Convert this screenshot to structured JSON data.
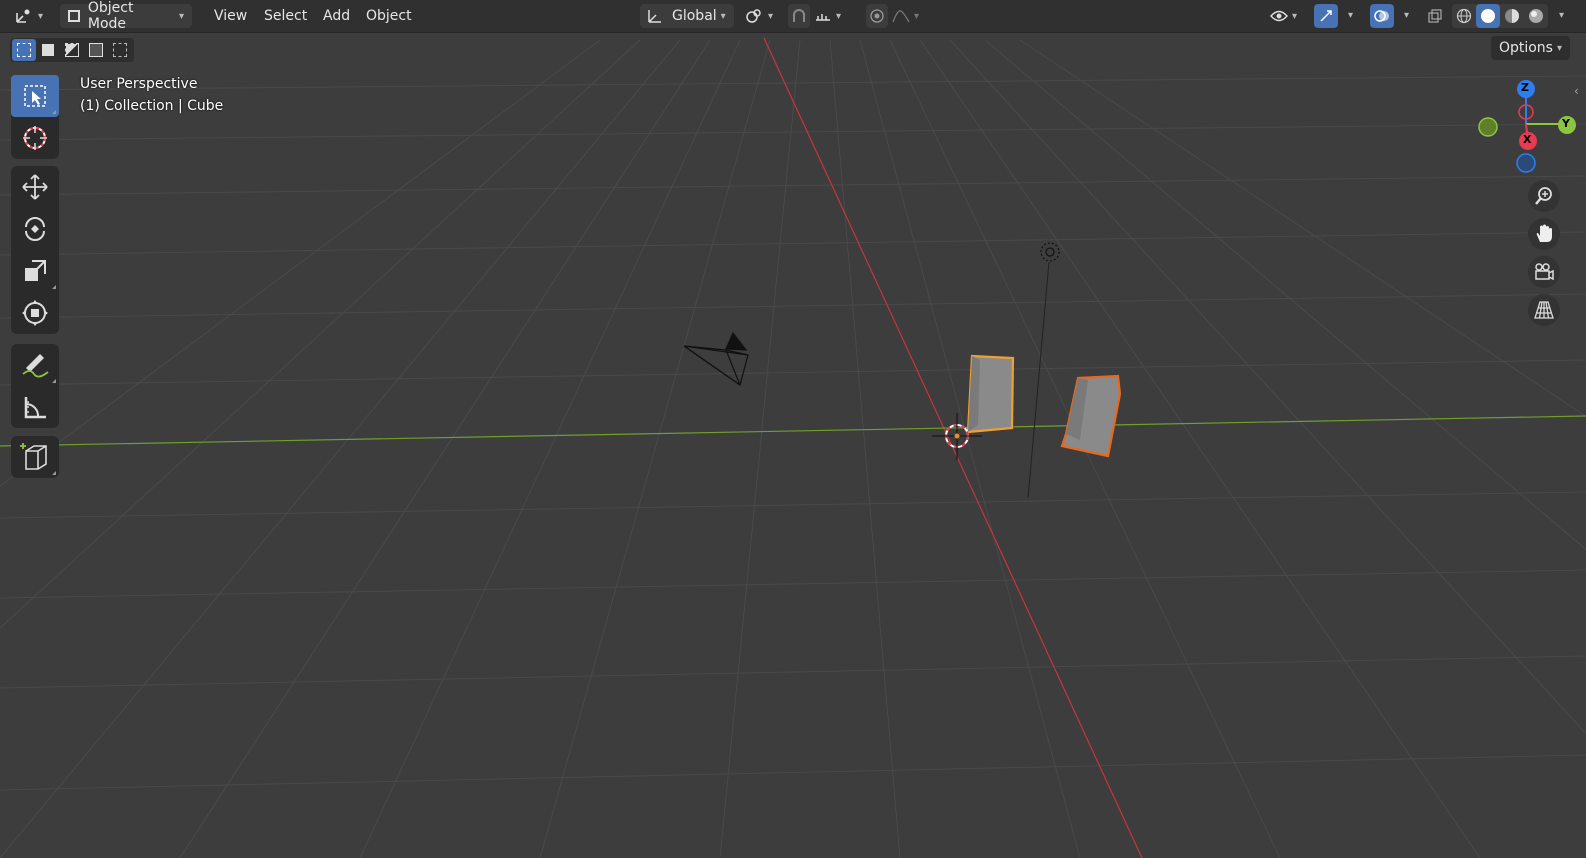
{
  "header": {
    "mode_label": "Object Mode",
    "menu": [
      "View",
      "Select",
      "Add",
      "Object"
    ],
    "orientation_label": "Global"
  },
  "options_label": "Options",
  "viewport": {
    "view_name": "User Perspective",
    "collection_label": "(1) Collection | Cube"
  },
  "gizmo": {
    "z_label": "Z",
    "y_label": "Y",
    "x_label": "X"
  },
  "toolbar": {
    "tools": [
      "select-box",
      "cursor",
      "move",
      "rotate",
      "scale",
      "transform",
      "annotate",
      "measure",
      "add-cube"
    ]
  },
  "colors": {
    "x_axis": "#e83a50",
    "y_axis": "#8cc63f",
    "z_axis": "#2f7ef0",
    "selected_outline": "#f08a24",
    "active_tool": "#4772b3"
  }
}
